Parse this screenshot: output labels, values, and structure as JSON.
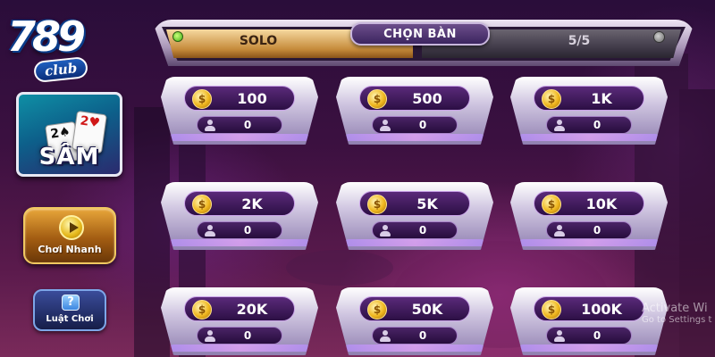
{
  "logo": {
    "digits": "789",
    "sub": "club"
  },
  "game": {
    "title": "SÂM",
    "card_a": "2♠",
    "card_b": "2♥"
  },
  "sidebar": {
    "quick_play_label": "Chơi Nhanh",
    "rules_label": "Luật Chơi",
    "rules_icon": "?"
  },
  "top_bar": {
    "mode_label": "SOLO",
    "title": "CHỌN BÀN",
    "count": "5/5"
  },
  "tables": [
    {
      "bet": "100",
      "players": "0"
    },
    {
      "bet": "500",
      "players": "0"
    },
    {
      "bet": "1K",
      "players": "0"
    },
    {
      "bet": "2K",
      "players": "0"
    },
    {
      "bet": "5K",
      "players": "0"
    },
    {
      "bet": "10K",
      "players": "0"
    },
    {
      "bet": "20K",
      "players": "0"
    },
    {
      "bet": "50K",
      "players": "0"
    },
    {
      "bet": "100K",
      "players": "0"
    }
  ],
  "coin_symbol": "$",
  "watermark": {
    "line1": "Activate Wi",
    "line2": "Go to Settings t"
  },
  "colors": {
    "accent_gold": "#c58a3a",
    "panel_purple": "#2c0f44",
    "active_dot": "#3fae14"
  }
}
